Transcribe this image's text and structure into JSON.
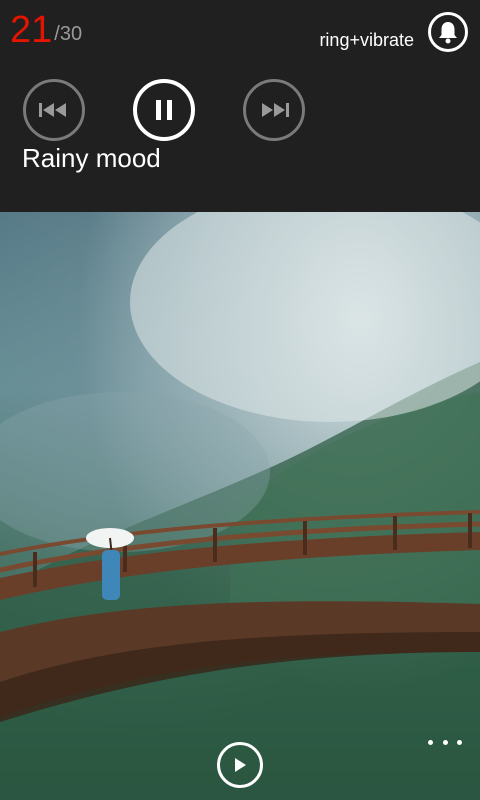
{
  "notification_counter": {
    "current": "21",
    "total": "/30"
  },
  "ringer": {
    "label": "ring+vibrate",
    "icon": "bell-icon"
  },
  "media": {
    "title": "Rainy mood",
    "controls": [
      "previous-track-icon",
      "pause-icon",
      "next-track-icon"
    ]
  },
  "wallpaper": {
    "description_icon": "wallpaper-image"
  },
  "bottom": {
    "play_icon": "play-icon",
    "more_icon": "ellipsis-icon"
  },
  "colors": {
    "accent": "#e51400",
    "panel": "#202020"
  }
}
